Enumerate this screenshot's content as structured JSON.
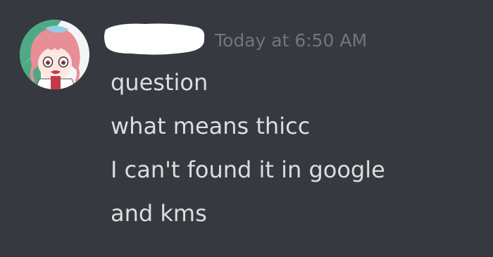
{
  "message": {
    "author_avatar_icon": "anime-girl-avatar-icon",
    "author_name_redacted": true,
    "timestamp": "Today at 6:50 AM",
    "lines": [
      "question",
      "what means thicc",
      "I can't found it in google",
      "and kms"
    ]
  },
  "colors": {
    "background": "#36393f",
    "text": "#dcddde",
    "timestamp": "#72767d",
    "redaction": "#ffffff"
  }
}
